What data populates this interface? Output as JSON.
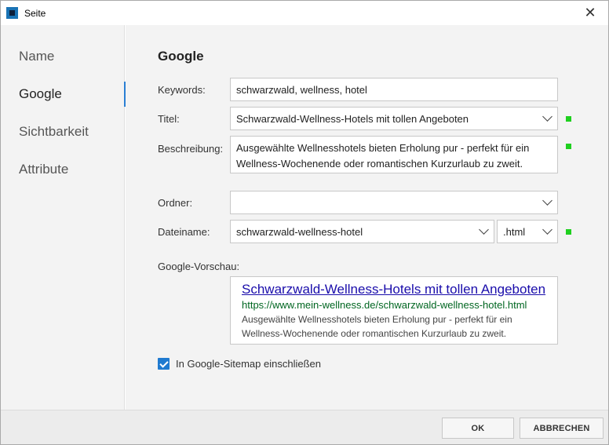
{
  "window": {
    "title": "Seite",
    "close_glyph": "✕"
  },
  "sidebar": {
    "items": [
      {
        "label": "Name"
      },
      {
        "label": "Google"
      },
      {
        "label": "Sichtbarkeit"
      },
      {
        "label": "Attribute"
      }
    ],
    "active": "Google"
  },
  "google": {
    "section_title": "Google",
    "keywords": {
      "label": "Keywords:",
      "value": "schwarzwald, wellness, hotel"
    },
    "titel": {
      "label": "Titel:",
      "value": "Schwarzwald-Wellness-Hotels mit tollen Angeboten"
    },
    "beschreibung": {
      "label": "Beschreibung:",
      "value": "Ausgewählte Wellnesshotels bieten Erholung pur - perfekt für ein Wellness-Wochenende oder romantischen Kurzurlaub zu zweit."
    },
    "ordner": {
      "label": "Ordner:",
      "value": ""
    },
    "dateiname": {
      "label": "Dateiname:",
      "value": "schwarzwald-wellness-hotel",
      "extension": ".html"
    },
    "preview": {
      "label": "Google-Vorschau:",
      "title": "Schwarzwald-Wellness-Hotels mit tollen Angeboten",
      "url": "https://www.mein-wellness.de/schwarzwald-wellness-hotel.html",
      "description_line1": "Ausgewählte Wellnesshotels bieten Erholung pur - perfekt für ein",
      "description_line2": "Wellness-Wochenende oder romantischen Kurzurlaub zu zweit."
    },
    "sitemap": {
      "label": "In Google-Sitemap einschließen",
      "checked": true
    }
  },
  "footer": {
    "ok_label": "OK",
    "cancel_label": "ABBRECHEN"
  },
  "colors": {
    "accent": "#2a7fd4",
    "status_ok": "#1fd01f",
    "link": "#1a0dab",
    "url": "#006621"
  }
}
